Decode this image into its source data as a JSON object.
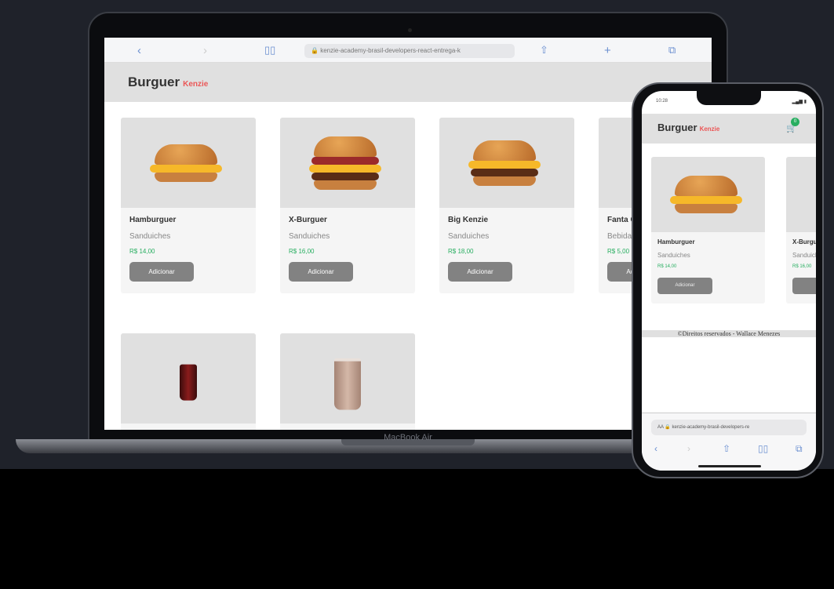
{
  "browser": {
    "url": "kenzie-academy-brasil-developers-react-entrega-k",
    "icons": [
      "chevron-left-icon",
      "chevron-right-icon",
      "book-icon",
      "share-icon",
      "plus-icon",
      "tabs-icon"
    ]
  },
  "header": {
    "brand": "Burguer",
    "brand_accent": "Kenzie"
  },
  "products": [
    {
      "name": "Hamburguer",
      "category": "Sanduiches",
      "price": "R$ 14,00",
      "button": "Adicionar"
    },
    {
      "name": "X-Burguer",
      "category": "Sanduiches",
      "price": "R$ 16,00",
      "button": "Adicionar"
    },
    {
      "name": "Big Kenzie",
      "category": "Sanduiches",
      "price": "R$ 18,00",
      "button": "Adicionar"
    },
    {
      "name": "Fanta G",
      "category": "Bebidas",
      "price": "R$ 5,00",
      "button": "Adicionar"
    }
  ],
  "laptop_label": "MacBook Air",
  "phone": {
    "status_time": "10:28",
    "cart_count": "0",
    "products": [
      {
        "name": "Hamburguer",
        "category": "Sanduiches",
        "price": "R$ 14,00",
        "button": "Adicionar"
      },
      {
        "name": "X-Burguer",
        "category": "Sanduiches",
        "price": "R$ 16,00"
      }
    ],
    "footer": "©Direitos reservados - Wallace Menezes",
    "url": "kenzie-academy-brasil-developers-re"
  },
  "colors": {
    "accent": "#eb5757",
    "price": "#27ae60",
    "button": "#828282",
    "header": "#e0e0e0"
  }
}
